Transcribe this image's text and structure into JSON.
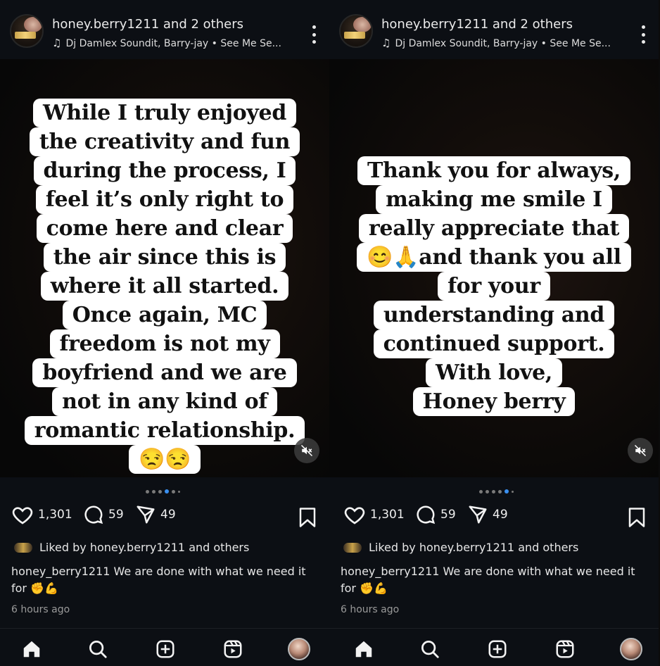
{
  "panels": [
    {
      "header": {
        "title": "honey.berry1211 and 2 others",
        "music": "Dj Damlex Soundit, Barry-jay • See Me Se..."
      },
      "caption_lines": [
        "While I truly enjoyed",
        "the creativity and fun",
        "during the process, I",
        "feel it’s only right to",
        "come here and clear",
        "the air since this is",
        "where it all started.",
        "Once again, MC",
        "freedom is not my",
        "boyfriend and we are",
        "not in any kind of",
        "romantic relationship.",
        "😒😒"
      ],
      "carousel": {
        "count": 6,
        "active_index": 3
      },
      "actions": {
        "likes": "1,301",
        "comments": "59",
        "shares": "49"
      },
      "liked_by": "Liked by honey.berry1211 and others",
      "caption": {
        "user": "honey_berry1211",
        "text": "We are done with what we need it for ✊💪"
      },
      "time": "6 hours ago"
    },
    {
      "header": {
        "title": "honey.berry1211 and 2 others",
        "music": "Dj Damlex Soundit, Barry-jay • See Me Se..."
      },
      "caption_lines": [
        "Thank you for always,",
        "making me smile I",
        "really appreciate that",
        "😊🙏and thank you all",
        "for your",
        "understanding and",
        "continued support.",
        "With love,",
        "Honey berry"
      ],
      "carousel": {
        "count": 6,
        "active_index": 4
      },
      "actions": {
        "likes": "1,301",
        "comments": "59",
        "shares": "49"
      },
      "liked_by": "Liked by honey.berry1211 and others",
      "caption": {
        "user": "honey_berry1211",
        "text": "We are done with what we need it for ✊💪"
      },
      "time": "6 hours ago"
    }
  ],
  "icons": {
    "music": "music-note-icon",
    "more": "kebab-menu-icon",
    "like": "heart-icon",
    "comment": "comment-bubble-icon",
    "share": "paper-plane-icon",
    "save": "bookmark-icon",
    "mute": "speaker-muted-icon",
    "tabs": [
      "home-icon",
      "search-icon",
      "create-post-icon",
      "reels-icon",
      "profile-avatar"
    ]
  },
  "colors": {
    "background": "#0c0f14",
    "active_dot": "#3a8fef",
    "caption_bg": "#ffffff",
    "caption_text": "#111111"
  }
}
